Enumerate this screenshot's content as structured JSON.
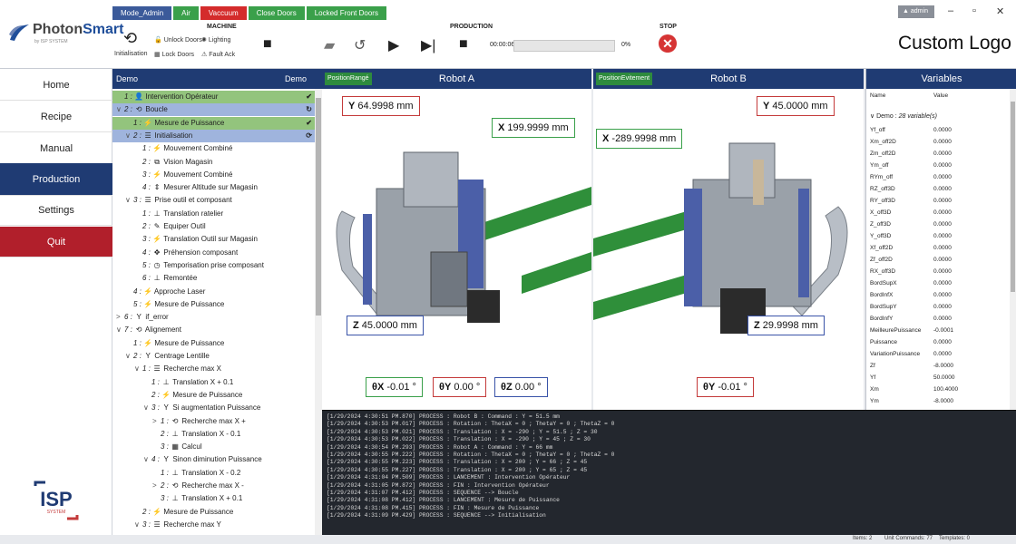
{
  "logo": {
    "brand1": "Photon",
    "brand2": "Smart",
    "sub": "by ISP SYSTEM"
  },
  "mode_chips": [
    {
      "label": "Mode_Admin",
      "color": "#3b5a9a"
    },
    {
      "label": "Air",
      "color": "#3aa04a"
    },
    {
      "label": "Vaccuum",
      "color": "#d42b2b"
    },
    {
      "label": "Close Doors",
      "color": "#3aa04a"
    },
    {
      "label": "Locked Front Doors",
      "color": "#3aa04a"
    }
  ],
  "machine": {
    "title": "MACHINE",
    "init": "Initialisation",
    "unlock": "Unlock Doors",
    "lighting": "Lighting",
    "lock": "Lock Doors",
    "fault": "Fault Ack"
  },
  "production": {
    "title": "PRODUCTION",
    "time": "00:00:06",
    "percent": "0%",
    "progress": 0
  },
  "stop": {
    "title": "STOP"
  },
  "user": {
    "name": "admin"
  },
  "custom_logo": "Custom Logo",
  "nav": [
    "Home",
    "Recipe",
    "Manual",
    "Production",
    "Settings",
    "Quit"
  ],
  "tree": {
    "head_left": "Demo",
    "head_right": "Demo",
    "rows": [
      {
        "d": 0,
        "e": "",
        "n": "1 :",
        "i": "👤",
        "t": "Intervention Opérateur",
        "bg": "g",
        "s": "✔"
      },
      {
        "d": 0,
        "e": "∨",
        "n": "2 :",
        "i": "⟲",
        "t": "Boucle",
        "bg": "b",
        "s": "↻"
      },
      {
        "d": 1,
        "e": "",
        "n": "1 :",
        "i": "⚡",
        "t": "Mesure de Puissance",
        "bg": "g",
        "s": "✔"
      },
      {
        "d": 1,
        "e": "∨",
        "n": "2 :",
        "i": "☰",
        "t": "Initialisation",
        "bg": "b",
        "s": "⟳"
      },
      {
        "d": 2,
        "e": "",
        "n": "1 :",
        "i": "⚡",
        "t": "Mouvement Combiné",
        "bg": "",
        "s": ""
      },
      {
        "d": 2,
        "e": "",
        "n": "2 :",
        "i": "⧉",
        "t": "Vision Magasin",
        "bg": "",
        "s": ""
      },
      {
        "d": 2,
        "e": "",
        "n": "3 :",
        "i": "⚡",
        "t": "Mouvement Combiné",
        "bg": "",
        "s": ""
      },
      {
        "d": 2,
        "e": "",
        "n": "4 :",
        "i": "⇕",
        "t": "Mesurer Altitude sur Magasin",
        "bg": "",
        "s": ""
      },
      {
        "d": 1,
        "e": "∨",
        "n": "3 :",
        "i": "☰",
        "t": "Prise outil et composant",
        "bg": "",
        "s": ""
      },
      {
        "d": 2,
        "e": "",
        "n": "1 :",
        "i": "⊥",
        "t": "Translation ratelier",
        "bg": "",
        "s": ""
      },
      {
        "d": 2,
        "e": "",
        "n": "2 :",
        "i": "✎",
        "t": "Equiper Outil",
        "bg": "",
        "s": ""
      },
      {
        "d": 2,
        "e": "",
        "n": "3 :",
        "i": "⚡",
        "t": "Translation Outil sur Magasin",
        "bg": "",
        "s": ""
      },
      {
        "d": 2,
        "e": "",
        "n": "4 :",
        "i": "✥",
        "t": "Préhension composant",
        "bg": "",
        "s": ""
      },
      {
        "d": 2,
        "e": "",
        "n": "5 :",
        "i": "◷",
        "t": "Temporisation prise composant",
        "bg": "",
        "s": ""
      },
      {
        "d": 2,
        "e": "",
        "n": "6 :",
        "i": "⊥",
        "t": "Remontée",
        "bg": "",
        "s": ""
      },
      {
        "d": 1,
        "e": "",
        "n": "4 :",
        "i": "⚡",
        "t": "Approche Laser",
        "bg": "",
        "s": ""
      },
      {
        "d": 1,
        "e": "",
        "n": "5 :",
        "i": "⚡",
        "t": "Mesure de Puissance",
        "bg": "",
        "s": ""
      },
      {
        "d": 0,
        "e": ">",
        "n": "6 :",
        "i": "Y",
        "t": "if_error",
        "bg": "",
        "s": ""
      },
      {
        "d": 0,
        "e": "∨",
        "n": "7 :",
        "i": "⟲",
        "t": "Alignement",
        "bg": "",
        "s": ""
      },
      {
        "d": 1,
        "e": "",
        "n": "1 :",
        "i": "⚡",
        "t": "Mesure de Puissance",
        "bg": "",
        "s": ""
      },
      {
        "d": 1,
        "e": "∨",
        "n": "2 :",
        "i": "Y",
        "t": "Centrage Lentille",
        "bg": "",
        "s": ""
      },
      {
        "d": 2,
        "e": "∨",
        "n": "1 :",
        "i": "☰",
        "t": "Recherche max X",
        "bg": "",
        "s": ""
      },
      {
        "d": 3,
        "e": "",
        "n": "1 :",
        "i": "⊥",
        "t": "Translation X + 0.1",
        "bg": "",
        "s": ""
      },
      {
        "d": 3,
        "e": "",
        "n": "2 :",
        "i": "⚡",
        "t": "Mesure de Puissance",
        "bg": "",
        "s": ""
      },
      {
        "d": 3,
        "e": "∨",
        "n": "3 :",
        "i": "Y",
        "t": "Si augmentation Puissance",
        "bg": "",
        "s": ""
      },
      {
        "d": 4,
        "e": ">",
        "n": "1 :",
        "i": "⟲",
        "t": "Recherche max X +",
        "bg": "",
        "s": ""
      },
      {
        "d": 4,
        "e": "",
        "n": "2 :",
        "i": "⊥",
        "t": "Translation X - 0.1",
        "bg": "",
        "s": ""
      },
      {
        "d": 4,
        "e": "",
        "n": "3 :",
        "i": "▦",
        "t": "Calcul",
        "bg": "",
        "s": ""
      },
      {
        "d": 3,
        "e": "∨",
        "n": "4 :",
        "i": "Y",
        "t": "Sinon diminution Puissance",
        "bg": "",
        "s": ""
      },
      {
        "d": 4,
        "e": "",
        "n": "1 :",
        "i": "⊥",
        "t": "Translation X - 0.2",
        "bg": "",
        "s": ""
      },
      {
        "d": 4,
        "e": ">",
        "n": "2 :",
        "i": "⟲",
        "t": "Recherche max X -",
        "bg": "",
        "s": ""
      },
      {
        "d": 4,
        "e": "",
        "n": "3 :",
        "i": "⊥",
        "t": "Translation X + 0.1",
        "bg": "",
        "s": ""
      },
      {
        "d": 2,
        "e": "",
        "n": "2 :",
        "i": "⚡",
        "t": "Mesure de Puissance",
        "bg": "",
        "s": ""
      },
      {
        "d": 2,
        "e": "∨",
        "n": "3 :",
        "i": "☰",
        "t": "Recherche max Y",
        "bg": "",
        "s": ""
      }
    ]
  },
  "robotA": {
    "tag": "PositionRangé",
    "title": "Robot A",
    "y": "64.9998 mm",
    "x": "199.9999 mm",
    "z": "45.0000 mm",
    "tx": "-0.01 °",
    "ty": "0.00 °",
    "tz": "0.00 °"
  },
  "robotB": {
    "tag": "PositionEvitement",
    "title": "Robot B",
    "y": "45.0000 mm",
    "x": "-289.9998 mm",
    "z": "29.9998 mm",
    "ty": "-0.01 °"
  },
  "variables": {
    "title": "Variables",
    "col_name": "Name",
    "col_value": "Value",
    "group": "Demo :",
    "group_count": "28 variable(s)",
    "rows": [
      [
        "Yf_off",
        "0.0000"
      ],
      [
        "Xm_off2D",
        "0.0000"
      ],
      [
        "Zm_off2D",
        "0.0000"
      ],
      [
        "Ym_off",
        "0.0000"
      ],
      [
        "RYm_off",
        "0.0000"
      ],
      [
        "RZ_off3D",
        "0.0000"
      ],
      [
        "RY_off3D",
        "0.0000"
      ],
      [
        "X_off3D",
        "0.0000"
      ],
      [
        "Z_off3D",
        "0.0000"
      ],
      [
        "Y_off3D",
        "0.0000"
      ],
      [
        "Xf_off2D",
        "0.0000"
      ],
      [
        "Zf_off2D",
        "0.0000"
      ],
      [
        "RX_off3D",
        "0.0000"
      ],
      [
        "BordSupX",
        "0.0000"
      ],
      [
        "BordInfX",
        "0.0000"
      ],
      [
        "BordSupY",
        "0.0000"
      ],
      [
        "BordInfY",
        "0.0000"
      ],
      [
        "MeilleurePuissance",
        "-0.0001"
      ],
      [
        "Puissance",
        "0.0000"
      ],
      [
        "VariationPuissance",
        "0.0000"
      ],
      [
        "Zf",
        "-8.0000"
      ],
      [
        "Yf",
        "50.0000"
      ],
      [
        "Xm",
        "100.4000"
      ],
      [
        "Ym",
        "-8.0000"
      ]
    ]
  },
  "log": [
    "[1/29/2024 4:30:51 PM.870] PROCESS : Robot B : Command : Y = 51.5 mm",
    "[1/29/2024 4:30:53 PM.017] PROCESS : Rotation : ThetaX = 0 ; ThetaY = 0 ; ThetaZ = 0",
    "[1/29/2024 4:30:53 PM.021] PROCESS : Translation : X = -290 ; Y = 51.5 ; Z = 30",
    "[1/29/2024 4:30:53 PM.022] PROCESS : Translation : X = -290 ; Y = 45 ; Z = 30",
    "[1/29/2024 4:30:54 PM.293] PROCESS : Robot A : Command : Y = 66 mm",
    "[1/29/2024 4:30:55 PM.222] PROCESS : Rotation : ThetaX = 0 ; ThetaY = 0 ; ThetaZ = 0",
    "[1/29/2024 4:30:55 PM.223] PROCESS : Translation : X = 200 ; Y = 66 ; Z = 45",
    "[1/29/2024 4:30:55 PM.227] PROCESS : Translation : X = 200 ; Y = 65 ; Z = 45",
    "[1/29/2024 4:31:04 PM.509] PROCESS : LANCEMENT : Intervention Opérateur",
    "[1/29/2024 4:31:05 PM.872] PROCESS : FIN : Intervention Opérateur",
    "[1/29/2024 4:31:07 PM.412] PROCESS : SEQUENCE --> Boucle",
    "[1/29/2024 4:31:08 PM.412] PROCESS : LANCEMENT : Mesure de Puissance",
    "[1/29/2024 4:31:08 PM.415] PROCESS : FIN : Mesure de Puissance",
    "[1/29/2024 4:31:09 PM.429] PROCESS : SEQUENCE --> Initialisation"
  ],
  "status": {
    "items": "Items: 2",
    "cmds": "Unit Commands: 77",
    "tpl": "Templates: 0"
  }
}
